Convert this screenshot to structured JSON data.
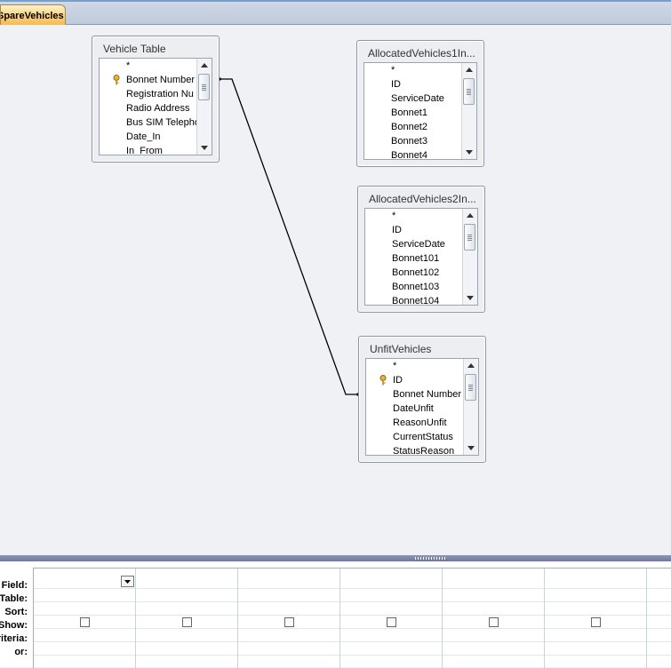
{
  "document_tab": {
    "label": "SpareVehicles"
  },
  "tables": [
    {
      "title": "Vehicle Table",
      "fields": [
        "*",
        "Bonnet Number",
        "Registration Nu",
        "Radio Address",
        "Bus SIM Telephone",
        "Date_In",
        "In_From"
      ]
    },
    {
      "title": "AllocatedVehicles1In...",
      "fields": [
        "*",
        "ID",
        "ServiceDate",
        "Bonnet1",
        "Bonnet2",
        "Bonnet3",
        "Bonnet4"
      ]
    },
    {
      "title": "AllocatedVehicles2In...",
      "fields": [
        "*",
        "ID",
        "ServiceDate",
        "Bonnet101",
        "Bonnet102",
        "Bonnet103",
        "Bonnet104"
      ]
    },
    {
      "title": "UnfitVehicles",
      "fields": [
        "*",
        "ID",
        "Bonnet Number",
        "DateUnfit",
        "ReasonUnfit",
        "CurrentStatus",
        "StatusReason"
      ]
    }
  ],
  "grid": {
    "row_labels": [
      "Field:",
      "Table:",
      "Sort:",
      "Show:",
      "Criteria:",
      "or:"
    ]
  },
  "colors": {
    "tab": "#f9cf7c",
    "splitter": "#7b83a8",
    "grid_line": "#c9d3df"
  }
}
